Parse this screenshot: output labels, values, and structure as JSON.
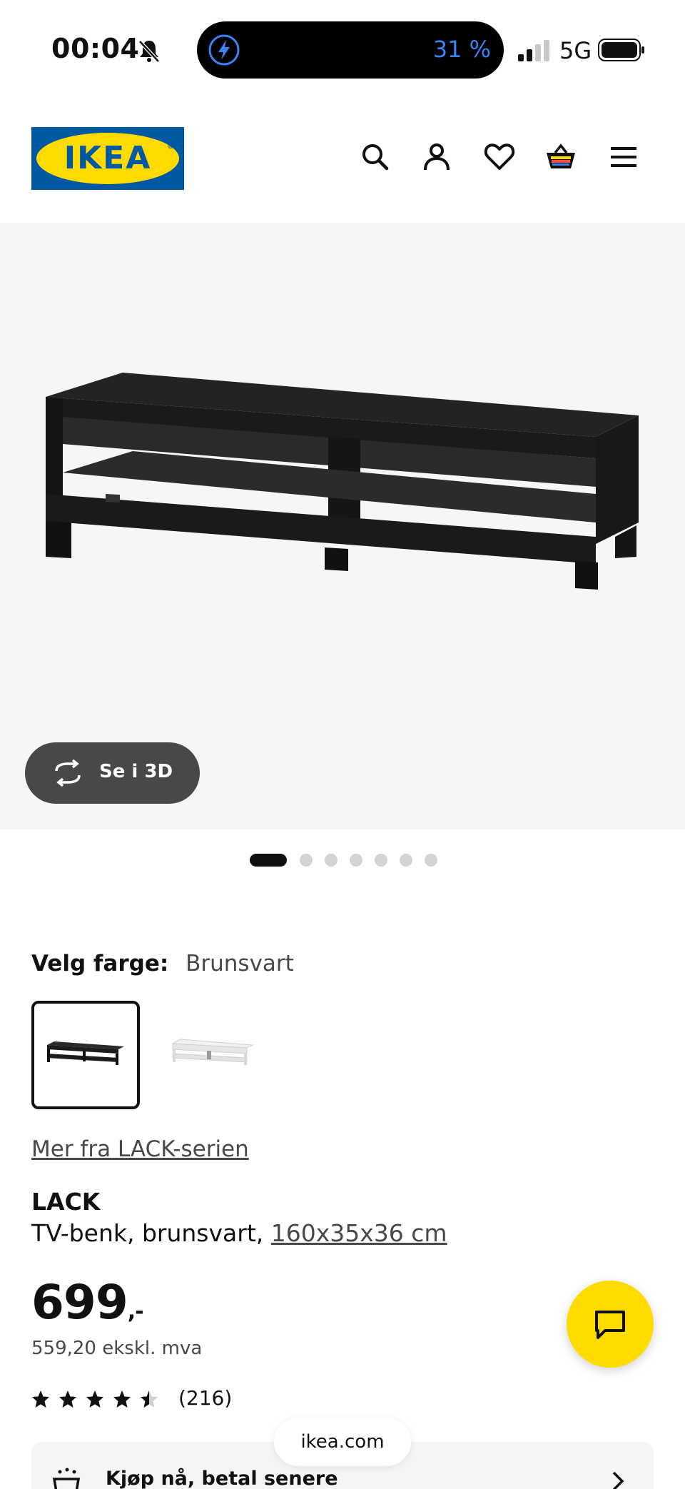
{
  "status_bar": {
    "time": "00:04",
    "battery_percent": "31 %",
    "network": "5G"
  },
  "header": {
    "logo_text": "IKEA",
    "icons": [
      "search-icon",
      "account-icon",
      "favorites-icon",
      "cart-icon",
      "menu-icon"
    ]
  },
  "gallery": {
    "view_3d_label": "Se i 3D",
    "dots_count": 7,
    "active_dot": 0
  },
  "product": {
    "color_label": "Velg farge:",
    "color_value": "Brunsvart",
    "swatches": [
      "brunsvart",
      "hvit"
    ],
    "series_link": "Mer fra LACK-serien",
    "name": "LACK",
    "desc_prefix": "TV-benk, brunsvart, ",
    "dimensions": "160x35x36 cm",
    "price_main": "699",
    "price_suffix": ",-",
    "price_ex_vat": "559,20 ekskl. mva",
    "rating": 4.5,
    "review_count": "(216)"
  },
  "bottom": {
    "bnpl_label": "Kjøp nå, betal senere",
    "url": "ikea.com"
  },
  "colors": {
    "ikea_blue": "#0058a3",
    "ikea_yellow": "#ffdb00",
    "product_dark": "#1e1e1e"
  }
}
